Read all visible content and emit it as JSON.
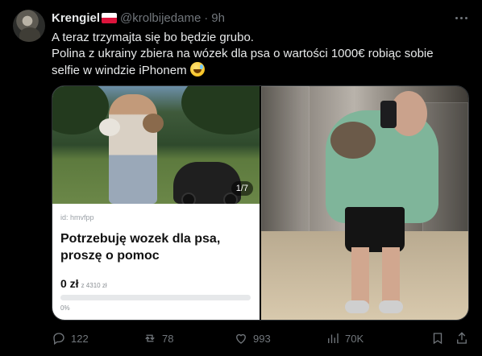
{
  "tweet": {
    "display_name": "Krengiel",
    "handle": "@krolbijedame",
    "separator": "·",
    "time": "9h",
    "text_lines": [
      "A teraz trzymajta się bo będzie grubo.",
      "Polina z ukrainy zbiera na wózek dla psa o wartości 1000€ robiąc sobie",
      "selfie w windzie iPhonem"
    ]
  },
  "media": {
    "left_card": {
      "image_counter": "1/7",
      "id_label": "id: hmvfpp",
      "title": "Potrzebuję wozek dla psa, proszę o pomoc",
      "raised": "0 zł",
      "goal": "z 4310 zł",
      "percent_label": "0%",
      "progress_fraction": 0,
      "progress_color": "#2ea44f"
    }
  },
  "actions": {
    "replies": "122",
    "retweets": "78",
    "likes": "993",
    "views": "70K"
  },
  "icons": [
    "avatar",
    "poland-flag-icon",
    "more-icon",
    "sweat-smile-emoji",
    "reply-icon",
    "retweet-icon",
    "like-icon",
    "views-icon",
    "bookmark-icon",
    "share-icon"
  ],
  "colors": {
    "background": "#000000",
    "text": "#e7e9ea",
    "muted": "#71767b"
  }
}
